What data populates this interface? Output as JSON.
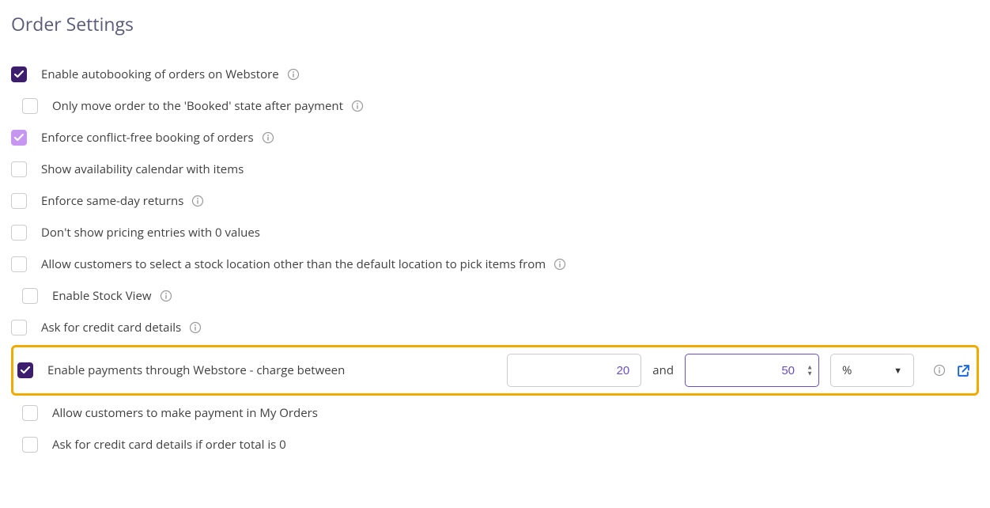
{
  "title": "Order Settings",
  "opts": {
    "autobooking": "Enable autobooking of orders on Webstore",
    "booked_after_pay": "Only move order to the 'Booked' state after payment",
    "conflict_free": "Enforce conflict-free booking of orders",
    "avail_cal": "Show availability calendar with items",
    "same_day": "Enforce same-day returns",
    "hide_zero": "Don't show pricing entries with 0 values",
    "stock_loc": "Allow customers to select a stock location other than the default location to pick items from",
    "stock_view": "Enable Stock View",
    "ask_cc": "Ask for credit card details",
    "enable_pay": "Enable payments through Webstore - charge between",
    "and": "and",
    "pay_myorders": "Allow customers to make payment in My Orders",
    "ask_cc_zero": "Ask for credit card details if order total is 0"
  },
  "pay": {
    "min": "20",
    "max": "50",
    "unit": "%"
  }
}
